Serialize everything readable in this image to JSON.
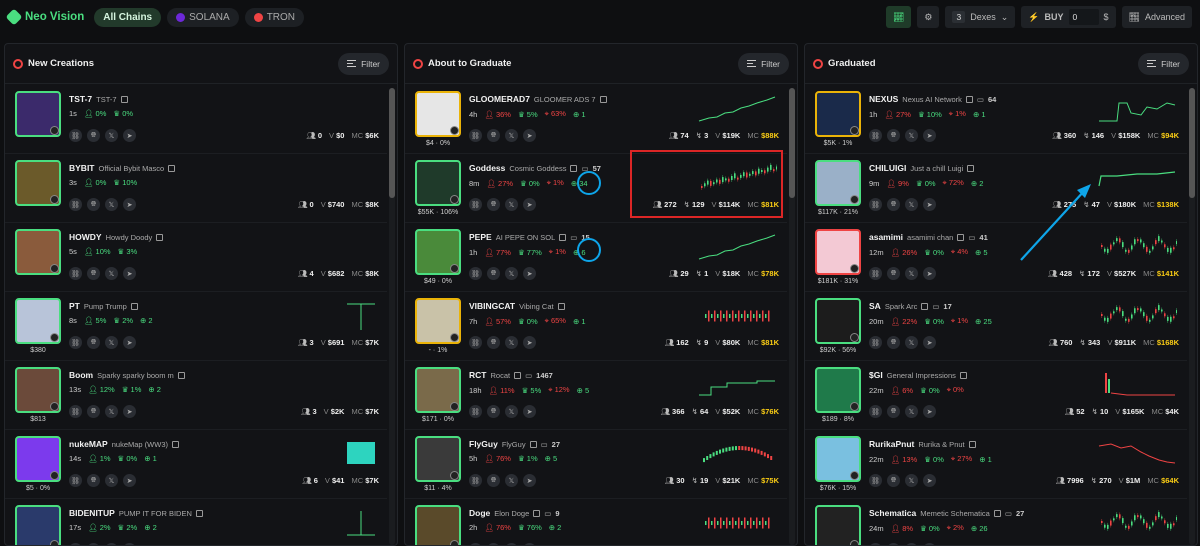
{
  "topbar": {
    "brand": "Neo Vision",
    "chains": [
      {
        "label": "All Chains",
        "active": true
      },
      {
        "label": "SOLANA",
        "dot": "#6d28d9"
      },
      {
        "label": "TRON",
        "dot": "#ef4444"
      }
    ],
    "dex_count": "3",
    "dex_label": "Dexes",
    "buy_label": "BUY",
    "buy_value": "0",
    "buy_unit": "$",
    "advanced_label": "Advanced"
  },
  "filter_label": "Filter",
  "columns": [
    {
      "title": "New Creations",
      "rows": [
        {
          "sym": "TST-7",
          "full": "TST-7",
          "age": "1s",
          "holders": "0%",
          "dev": "0%",
          "under": "",
          "vol": "0",
          "tx": "",
          "v": "$0",
          "mc": "$6K",
          "color": "#3b2a6b",
          "border": "green",
          "chart": "none"
        },
        {
          "sym": "BYBIT",
          "full": "Official Bybit Masco",
          "age": "3s",
          "holders": "0%",
          "dev": "10%",
          "under": "",
          "vol": "0",
          "tx": "",
          "v": "$740",
          "mc": "$8K",
          "color": "#6b5a2a",
          "border": "green",
          "chart": "none"
        },
        {
          "sym": "HOWDY",
          "full": "Howdy Doody",
          "age": "5s",
          "holders": "10%",
          "dev": "3%",
          "under": "",
          "vol": "4",
          "tx": "",
          "v": "$682",
          "mc": "$8K",
          "color": "#8a5b3c",
          "border": "green",
          "chart": "none"
        },
        {
          "sym": "PT",
          "full": "Pump Trump",
          "age": "8s",
          "holders": "5%",
          "dev": "2%",
          "extra": "2",
          "under": "$380",
          "vol": "3",
          "tx": "",
          "v": "$691",
          "mc": "$7K",
          "color": "#b8c4d9",
          "border": "green",
          "chart": "T"
        },
        {
          "sym": "Boom",
          "full": "Sparky sparky boom m",
          "age": "13s",
          "holders": "12%",
          "dev": "1%",
          "extra": "2",
          "under": "$813",
          "vol": "3",
          "tx": "",
          "v": "$2K",
          "mc": "$7K",
          "color": "#6b4a3a",
          "border": "green",
          "chart": "none"
        },
        {
          "sym": "nukeMAP",
          "full": "nukeMap (WW3)",
          "age": "14s",
          "holders": "1%",
          "dev": "0%",
          "extra": "1",
          "under": "$5 · 0%",
          "vol": "6",
          "tx": "",
          "v": "$41",
          "mc": "$7K",
          "color": "#7c3aed",
          "border": "green",
          "chart": "block"
        },
        {
          "sym": "BIDENITUP",
          "full": "PUMP IT FOR BIDEN",
          "age": "17s",
          "holders": "2%",
          "dev": "2%",
          "extra": "2",
          "under": "",
          "vol": "",
          "tx": "",
          "v": "",
          "mc": "",
          "color": "#2a3a6b",
          "border": "green",
          "chart": "T2"
        }
      ]
    },
    {
      "title": "About to Graduate",
      "rows": [
        {
          "sym": "GLOOMERAD7",
          "full": "GLOOMER ADS 7",
          "age": "4h",
          "holders": "36%",
          "dev": "5%",
          "snipe": "63%",
          "extra": "1",
          "under": "$4 · 0%",
          "vol": "74",
          "tx": "3",
          "v": "$19K",
          "mc": "$88K",
          "color": "#e6e6e6",
          "border": "yellow",
          "chart": "up",
          "mchi": true
        },
        {
          "sym": "Goddess",
          "full": "Cosmic Goddess",
          "cnt": "57",
          "age": "8m",
          "holders": "27%",
          "dev": "0%",
          "snipe": "1%",
          "extra": "34",
          "under": "$55K · 106%",
          "vol": "272",
          "tx": "129",
          "v": "$114K",
          "mc": "$81K",
          "color": "#1f3a2a",
          "border": "green",
          "chart": "candle",
          "mchi": true
        },
        {
          "sym": "PEPE",
          "full": "AI PEPE ON SOL",
          "cnt": "15",
          "age": "1h",
          "holders": "77%",
          "dev": "77%",
          "snipe": "1%",
          "extra": "6",
          "under": "$49 · 0%",
          "vol": "29",
          "tx": "1",
          "v": "$18K",
          "mc": "$78K",
          "color": "#4a8a3a",
          "border": "green",
          "chart": "up",
          "mchi": true
        },
        {
          "sym": "VIBINGCAT",
          "full": "Vibing Cat",
          "age": "7h",
          "holders": "57%",
          "dev": "0%",
          "snipe": "65%",
          "extra": "1",
          "under": "- · 1%",
          "vol": "162",
          "tx": "9",
          "v": "$80K",
          "mc": "$81K",
          "color": "#c9c2a8",
          "border": "yellow",
          "chart": "bars",
          "mchi": true
        },
        {
          "sym": "RCT",
          "full": "Rocat",
          "cnt": "1467",
          "age": "18h",
          "holders": "11%",
          "dev": "5%",
          "snipe": "12%",
          "extra": "5",
          "under": "$171 · 0%",
          "vol": "366",
          "tx": "64",
          "v": "$52K",
          "mc": "$76K",
          "color": "#7a6a4a",
          "border": "green",
          "chart": "step",
          "mchi": true
        },
        {
          "sym": "FlyGuy",
          "full": "FlyGuy",
          "cnt": "27",
          "age": "5h",
          "holders": "76%",
          "dev": "1%",
          "extra": "5",
          "under": "$11 · 4%",
          "vol": "30",
          "tx": "19",
          "v": "$21K",
          "mc": "$75K",
          "color": "#3a3a3a",
          "border": "green",
          "chart": "arc",
          "mchi": true
        },
        {
          "sym": "Doge",
          "full": "Elon Doge",
          "cnt": "9",
          "age": "2h",
          "holders": "76%",
          "dev": "76%",
          "extra": "2",
          "under": "",
          "vol": "",
          "tx": "",
          "v": "",
          "mc": "",
          "color": "#5a4a2a",
          "border": "green",
          "chart": "bars2"
        }
      ]
    },
    {
      "title": "Graduated",
      "rows": [
        {
          "sym": "NEXUS",
          "full": "Nexus AI Network",
          "cnt": "64",
          "age": "1h",
          "holders": "27%",
          "dev": "10%",
          "snipe": "1%",
          "extra": "1",
          "under": "$5K · 1%",
          "vol": "360",
          "tx": "146",
          "v": "$158K",
          "mc": "$94K",
          "color": "#1a2a4a",
          "border": "yellow",
          "chart": "jump",
          "mchi": true
        },
        {
          "sym": "CHILUIGI",
          "full": "Just a chill Luigi",
          "age": "9m",
          "holders": "9%",
          "dev": "0%",
          "snipe": "72%",
          "extra": "2",
          "under": "$117K · 21%",
          "vol": "275",
          "tx": "47",
          "v": "$180K",
          "mc": "$138K",
          "color": "#9ab0c8",
          "border": "green",
          "chart": "flat",
          "mchi": true
        },
        {
          "sym": "asamimi",
          "full": "asamimi chan",
          "cnt": "41",
          "age": "12m",
          "holders": "26%",
          "dev": "0%",
          "snipe": "4%",
          "extra": "5",
          "under": "$181K · 31%",
          "vol": "428",
          "tx": "172",
          "v": "$527K",
          "mc": "$141K",
          "color": "#f3c9d4",
          "border": "red",
          "chart": "candle2",
          "mchi": true
        },
        {
          "sym": "SA",
          "full": "Spark Arc",
          "cnt": "17",
          "age": "20m",
          "holders": "22%",
          "dev": "0%",
          "snipe": "1%",
          "extra": "25",
          "under": "$92K · 56%",
          "vol": "760",
          "tx": "343",
          "v": "$911K",
          "mc": "$168K",
          "color": "#1c1c1c",
          "border": "green",
          "chart": "candle2",
          "mchi": true
        },
        {
          "sym": "$GI",
          "full": "General Impressions",
          "age": "22m",
          "holders": "6%",
          "dev": "0%",
          "snipe": "0%",
          "extra": "",
          "under": "$189 · 8%",
          "vol": "52",
          "tx": "10",
          "v": "$165K",
          "mc": "$4K",
          "color": "#1f7a4a",
          "border": "green",
          "chart": "dump",
          "mchi": false
        },
        {
          "sym": "RurikaPnut",
          "full": "Rurika & Pnut",
          "age": "22m",
          "holders": "13%",
          "dev": "0%",
          "snipe": "27%",
          "extra": "1",
          "under": "$76K · 15%",
          "vol": "7996",
          "tx": "270",
          "v": "$1M",
          "mc": "$64K",
          "color": "#7ac0e0",
          "border": "green",
          "chart": "down",
          "mchi": true
        },
        {
          "sym": "Schematica",
          "full": "Memetic Schematica",
          "cnt": "27",
          "age": "24m",
          "holders": "8%",
          "dev": "0%",
          "snipe": "2%",
          "extra": "26",
          "under": "",
          "vol": "",
          "tx": "",
          "v": "",
          "mc": "",
          "color": "#222",
          "border": "green",
          "chart": "candle2"
        }
      ]
    }
  ]
}
